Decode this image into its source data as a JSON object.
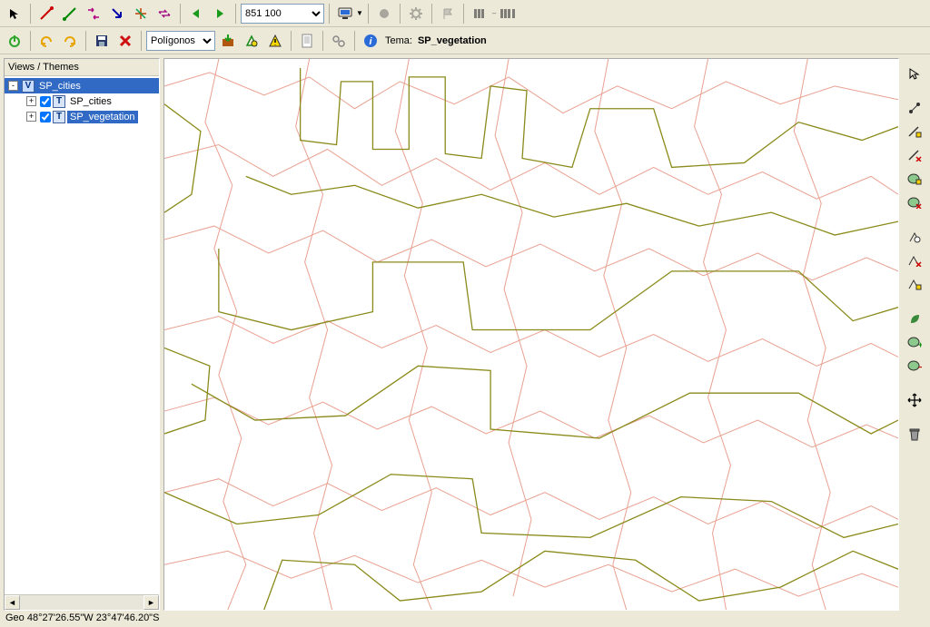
{
  "toolbar1": {
    "scale_value": "851 100",
    "icons": {
      "pointer": "pointer-icon",
      "pen_red": "pen-red-icon",
      "pen_green": "pen-green-icon",
      "link_arrows": "link-arrows-icon",
      "arrow_down_right": "arrow-down-right-icon",
      "multi_arrow": "multi-arrow-icon",
      "swap": "swap-icon",
      "back": "back-icon",
      "forward": "forward-icon",
      "monitor": "monitor-icon",
      "circle": "circle-icon",
      "gear": "gear-icon",
      "flag": "flag-icon",
      "stripes1": "three-bars-icon",
      "stripes2": "three-bars-group-icon"
    }
  },
  "toolbar2": {
    "geom_combo": "Polígonos",
    "tema_label": "Tema:",
    "tema_value": "SP_vegetation",
    "icons": {
      "power": "power-icon",
      "undo": "undo-icon",
      "redo": "redo-icon",
      "save": "save-icon",
      "delete": "delete-icon",
      "import": "import-icon",
      "geom_tool": "geom-tool-icon",
      "warn": "warning-icon",
      "doc": "document-icon",
      "gears": "gears-icon",
      "info": "info-icon"
    }
  },
  "sidebar": {
    "title": "Views / Themes",
    "nodes": [
      {
        "icon": "V",
        "label": "SP_cities",
        "selected": true,
        "depth": 0,
        "exp": "-",
        "check": false
      },
      {
        "icon": "T",
        "label": "SP_cities",
        "selected": false,
        "depth": 1,
        "exp": "+",
        "check": true
      },
      {
        "icon": "T",
        "label": "SP_vegetation",
        "selected": true,
        "depth": 1,
        "exp": "+",
        "check": true,
        "lblsel": true
      }
    ]
  },
  "right_tools": [
    "cursor-icon",
    "connect-points-icon",
    "edge-add-icon",
    "edge-remove-icon",
    "polygon-add-icon",
    "polygon-remove-icon",
    "edit-select-icon",
    "edit-delete-icon",
    "edit-modify-icon",
    "leaf-icon",
    "polygon-add2-icon",
    "polygon-del2-icon",
    "move-icon",
    "trash-icon"
  ],
  "status": {
    "coords": "Geo 48°27'26.55\"W 23°47'46.20\"S"
  },
  "map": {
    "layers": [
      {
        "name": "SP_cities",
        "stroke": "#e9a090"
      },
      {
        "name": "SP_vegetation",
        "stroke": "#8a8a1a"
      }
    ]
  }
}
